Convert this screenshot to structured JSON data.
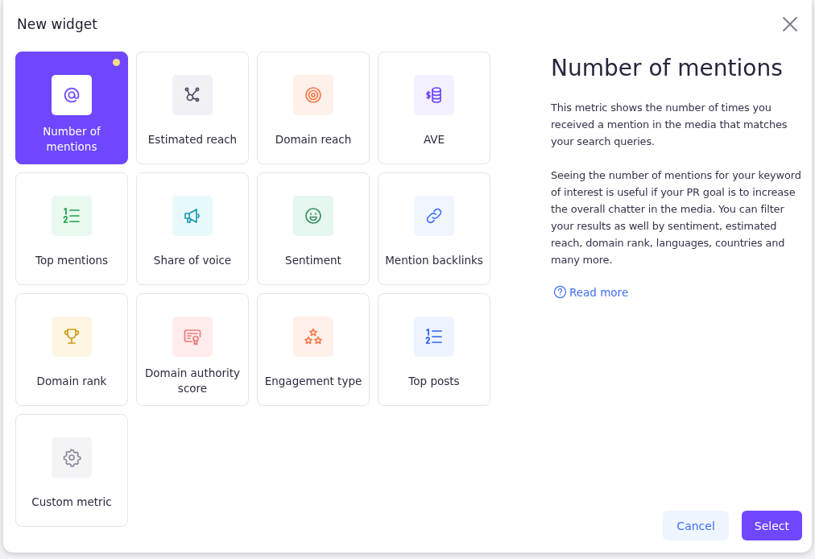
{
  "dialog": {
    "title": "New widget"
  },
  "tiles": [
    {
      "label": "Number of mentions",
      "kind": "at",
      "selected": true,
      "flagged": true
    },
    {
      "label": "Estimated reach",
      "kind": "network",
      "selected": false,
      "flagged": false
    },
    {
      "label": "Domain reach",
      "kind": "target",
      "selected": false,
      "flagged": false
    },
    {
      "label": "AVE",
      "kind": "coins",
      "selected": false,
      "flagged": false
    },
    {
      "label": "Top mentions",
      "kind": "list-green",
      "selected": false,
      "flagged": false
    },
    {
      "label": "Share of voice",
      "kind": "megaphone",
      "selected": false,
      "flagged": false
    },
    {
      "label": "Sentiment",
      "kind": "smile",
      "selected": false,
      "flagged": false
    },
    {
      "label": "Mention backlinks",
      "kind": "link",
      "selected": false,
      "flagged": false
    },
    {
      "label": "Domain rank",
      "kind": "trophy",
      "selected": false,
      "flagged": false
    },
    {
      "label": "Domain authority score",
      "kind": "certificate",
      "selected": false,
      "flagged": false
    },
    {
      "label": "Engagement type",
      "kind": "stars",
      "selected": false,
      "flagged": false
    },
    {
      "label": "Top posts",
      "kind": "list-blue",
      "selected": false,
      "flagged": false
    },
    {
      "label": "Custom metric",
      "kind": "gear",
      "selected": false,
      "flagged": false
    }
  ],
  "details": {
    "heading": "Number of mentions",
    "paragraphs": [
      "This metric shows the number of times you received a mention in the media that matches your search queries.",
      "Seeing the number of mentions for your keyword of interest is useful if your PR goal is to increase the overall chatter in the media. You can filter your results as well by sentiment, estimated reach, domain rank, languages, countries and many more."
    ],
    "link": "Read more"
  },
  "buttons": [
    {
      "label": "Cancel",
      "kind": "secondary"
    },
    {
      "label": "Select",
      "kind": "primary"
    }
  ]
}
